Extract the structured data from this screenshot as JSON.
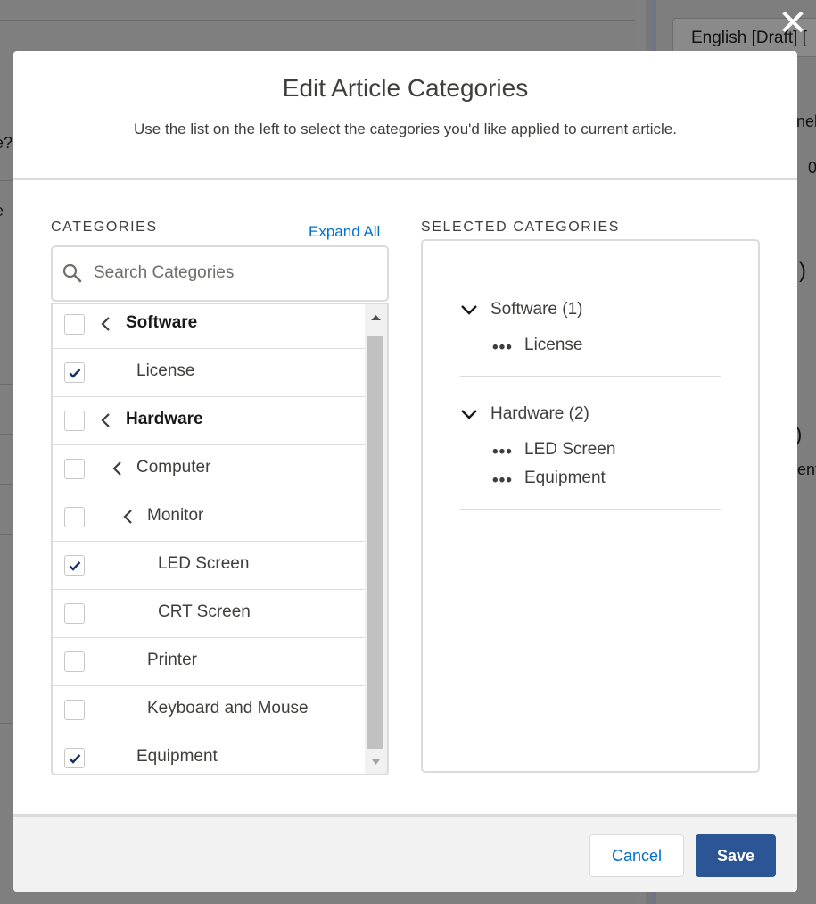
{
  "background": {
    "language_select": "English [Draft] [",
    "fragments": [
      "e?",
      "e",
      "nel",
      "0",
      ")",
      ")",
      "ent"
    ]
  },
  "modal": {
    "title": "Edit Article Categories",
    "subtitle": "Use the list on the left to select the categories you'd like applied to current article.",
    "close_icon": "close-icon"
  },
  "categories": {
    "label": "CATEGORIES",
    "expand_all": "Expand All",
    "search_placeholder": "Search Categories",
    "search_value": "",
    "rows": [
      {
        "label": "Software",
        "checked": false,
        "expandable": true,
        "bold": true
      },
      {
        "label": "License",
        "checked": true,
        "expandable": false,
        "bold": false
      },
      {
        "label": "Hardware",
        "checked": false,
        "expandable": true,
        "bold": true
      },
      {
        "label": "Computer",
        "checked": false,
        "expandable": true,
        "bold": false
      },
      {
        "label": "Monitor",
        "checked": false,
        "expandable": true,
        "bold": false
      },
      {
        "label": "LED Screen",
        "checked": true,
        "expandable": false,
        "bold": false
      },
      {
        "label": "CRT Screen",
        "checked": false,
        "expandable": false,
        "bold": false
      },
      {
        "label": "Printer",
        "checked": false,
        "expandable": false,
        "bold": false
      },
      {
        "label": "Keyboard and Mouse",
        "checked": false,
        "expandable": false,
        "bold": false
      },
      {
        "label": "Equipment",
        "checked": true,
        "expandable": false,
        "bold": false
      }
    ]
  },
  "selected": {
    "label": "SELECTED CATEGORIES",
    "groups": [
      {
        "title": "Software (1)",
        "items": [
          "License"
        ]
      },
      {
        "title": "Hardware (2)",
        "items": [
          "LED Screen",
          "Equipment"
        ]
      }
    ],
    "item_marker": "•••"
  },
  "footer": {
    "cancel_label": "Cancel",
    "save_label": "Save"
  },
  "colors": {
    "link": "#0070d2",
    "save_bg": "#2b5595",
    "border": "#dddbda",
    "check": "#16325c"
  }
}
